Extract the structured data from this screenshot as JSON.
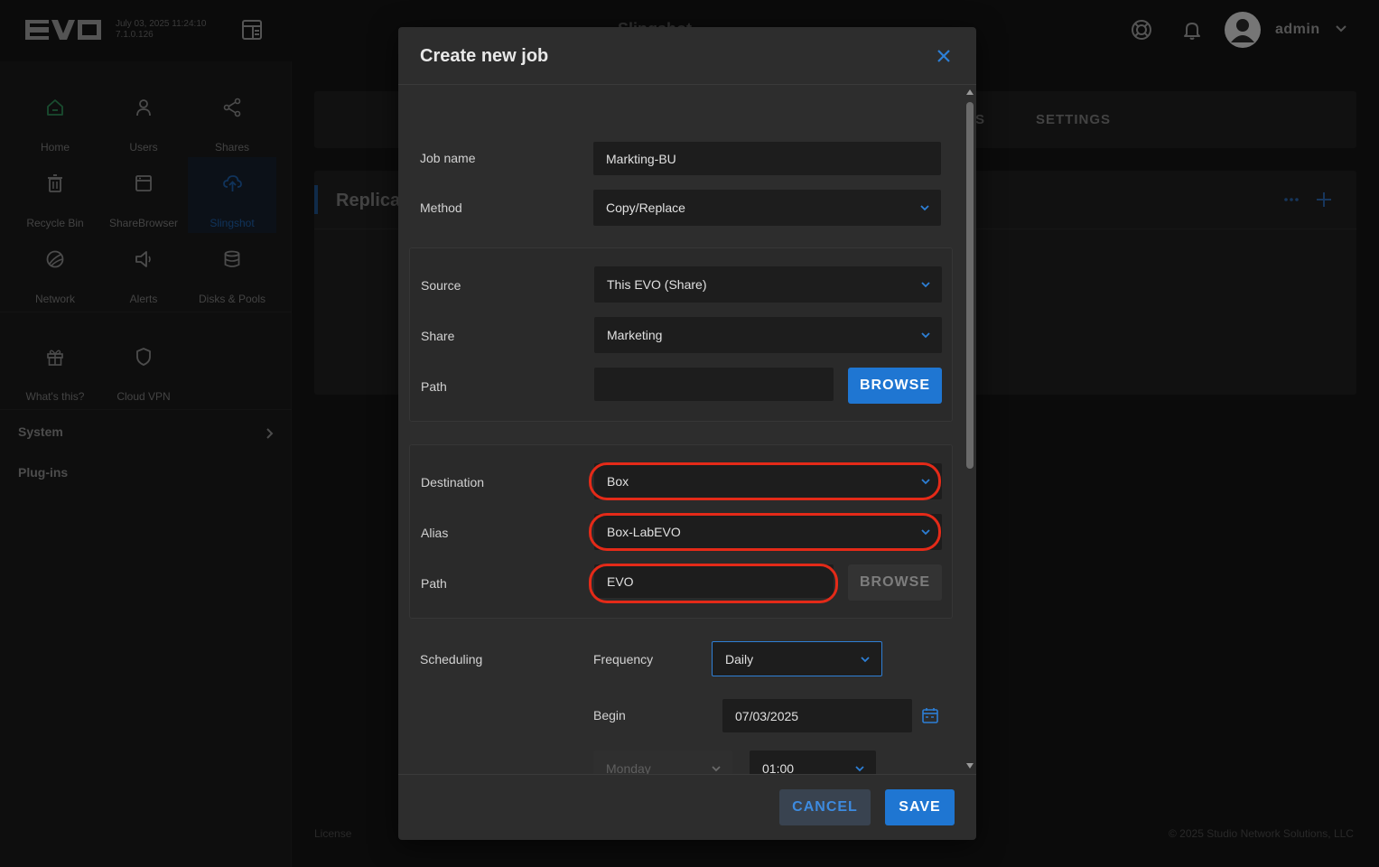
{
  "topbar": {
    "brand": "EVO",
    "datetime": "July 03, 2025 11:24:10",
    "version": "7.1.0.126",
    "page_title": "Slingshot",
    "username": "admin"
  },
  "sidebar": {
    "grid": [
      {
        "label": "Home",
        "icon": "home-icon"
      },
      {
        "label": "Users",
        "icon": "user-icon"
      },
      {
        "label": "Shares",
        "icon": "share-icon"
      },
      {
        "label": "Recycle Bin",
        "icon": "trash-icon"
      },
      {
        "label": "ShareBrowser",
        "icon": "browser-icon"
      },
      {
        "label": "Slingshot",
        "icon": "cloud-upload-icon"
      },
      {
        "label": "Network",
        "icon": "network-icon"
      },
      {
        "label": "Alerts",
        "icon": "megaphone-icon"
      },
      {
        "label": "Disks & Pools",
        "icon": "database-icon"
      },
      {
        "label": "What's this?",
        "icon": "gift-icon"
      },
      {
        "label": "Cloud VPN",
        "icon": "shield-icon"
      }
    ],
    "system_label": "System",
    "plugins_label": "Plug-ins"
  },
  "background": {
    "tab_partial": "S",
    "tab_settings": "SETTINGS",
    "card_title": "Replicat",
    "license": "License",
    "copyright": "© 2025 Studio Network Solutions, LLC"
  },
  "modal": {
    "title": "Create new job",
    "job_name": {
      "label": "Job name",
      "value": "Markting-BU"
    },
    "method": {
      "label": "Method",
      "value": "Copy/Replace"
    },
    "source": {
      "source_label": "Source",
      "source_value": "This EVO (Share)",
      "share_label": "Share",
      "share_value": "Marketing",
      "path_label": "Path",
      "path_value": "",
      "browse": "BROWSE"
    },
    "destination": {
      "destination_label": "Destination",
      "destination_value": "Box",
      "alias_label": "Alias",
      "alias_value": "Box-LabEVO",
      "path_label": "Path",
      "path_value": "EVO",
      "browse": "BROWSE"
    },
    "scheduling": {
      "label": "Scheduling",
      "frequency_label": "Frequency",
      "frequency_value": "Daily",
      "begin_label": "Begin",
      "begin_value": "07/03/2025",
      "day_value": "Monday",
      "time_value": "01:00"
    },
    "cancel": "CANCEL",
    "save": "SAVE"
  },
  "colors": {
    "accent": "#1f76d2",
    "highlight": "#e42a18",
    "active_nav": "#16202c",
    "home_icon": "#2f8a57"
  }
}
